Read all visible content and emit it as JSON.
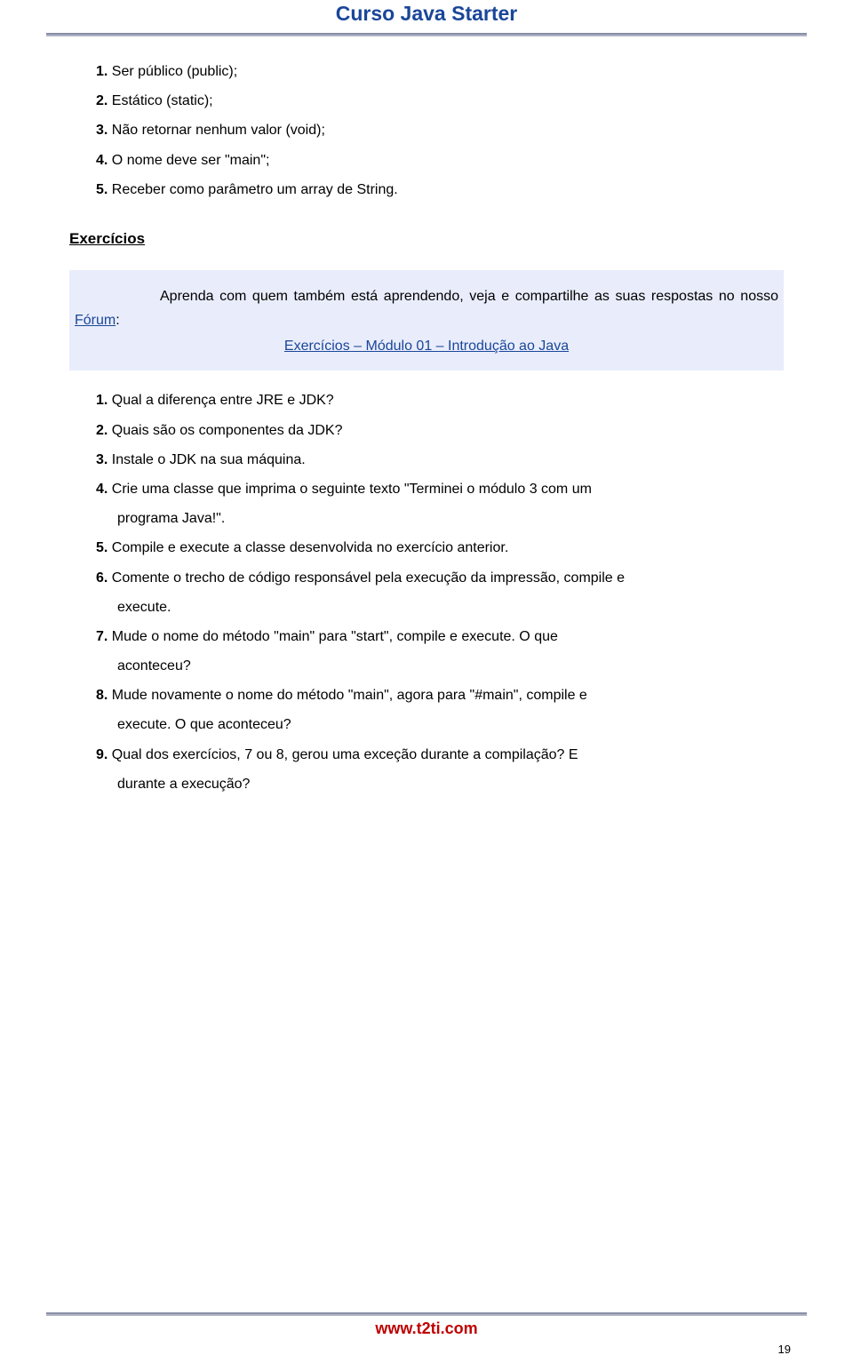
{
  "header": {
    "title": "Curso Java Starter"
  },
  "intro_list": [
    {
      "num": "1.",
      "text": "Ser público (public);"
    },
    {
      "num": "2.",
      "text": "Estático (static);"
    },
    {
      "num": "3.",
      "text": "Não retornar nenhum valor (void);"
    },
    {
      "num": "4.",
      "text": "O nome deve ser \"main\";"
    },
    {
      "num": "5.",
      "text": "Receber como parâmetro um array de String."
    }
  ],
  "exercicios_heading": "Exercícios",
  "callout": {
    "pre_text": "Aprenda com quem também está aprendendo, veja e compartilhe as suas respostas no nosso ",
    "link1": "Fórum",
    "post_text": ":",
    "link2": "Exercícios – Módulo 01 – Introdução ao Java"
  },
  "exercises": [
    {
      "num": "1.",
      "text": "Qual a diferença entre JRE e JDK?",
      "cont": ""
    },
    {
      "num": "2.",
      "text": "Quais são os componentes da JDK?",
      "cont": ""
    },
    {
      "num": "3.",
      "text": "Instale o JDK na sua máquina.",
      "cont": ""
    },
    {
      "num": "4.",
      "text": "Crie uma classe que imprima o seguinte texto \"Terminei o módulo 3 com um",
      "cont": "programa Java!\"."
    },
    {
      "num": "5.",
      "text": "Compile e execute a classe desenvolvida no exercício anterior.",
      "cont": ""
    },
    {
      "num": "6.",
      "text": "Comente o trecho de código responsável pela execução da impressão, compile e",
      "cont": "execute."
    },
    {
      "num": "7.",
      "text": "Mude  o  nome  do  método  \"main\"  para  \"start\",  compile  e  execute.  O  que",
      "cont": "aconteceu?"
    },
    {
      "num": "8.",
      "text": "Mude novamente o nome do método \"main\", agora para \"#main\", compile e",
      "cont": "execute. O que aconteceu?"
    },
    {
      "num": "9.",
      "text": "Qual  dos  exercícios,  7  ou  8,  gerou  uma  exceção  durante  a  compilação?  E",
      "cont": "durante a execução?"
    }
  ],
  "footer": {
    "url": "www.t2ti.com"
  },
  "page_number": "19"
}
